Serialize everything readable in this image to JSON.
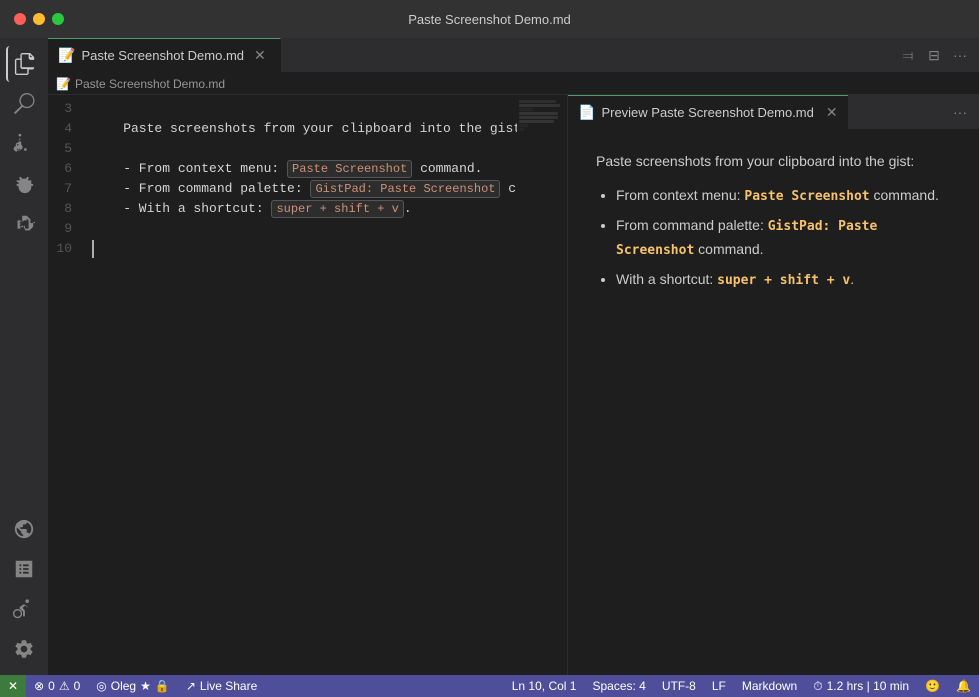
{
  "titlebar": {
    "title": "Paste Screenshot Demo.md"
  },
  "tabs": {
    "active_label": "Paste Screenshot Demo.md",
    "active_icon": "📄",
    "breadcrumb_text": "Paste Screenshot Demo.md"
  },
  "preview_tab": {
    "label": "Preview Paste Screenshot Demo.md"
  },
  "code_lines": [
    {
      "num": "3",
      "content": ""
    },
    {
      "num": "4",
      "content": "    Paste screenshots from your clipboard into the gist:"
    },
    {
      "num": "5",
      "content": ""
    },
    {
      "num": "6",
      "content": "    - From context menu: `Paste Screenshot` command."
    },
    {
      "num": "7",
      "content": "    - From command palette: `GistPad: Paste Screenshot` command."
    },
    {
      "num": "8",
      "content": "    - With a shortcut: `super + shift + v`."
    },
    {
      "num": "9",
      "content": ""
    },
    {
      "num": "10",
      "content": ""
    }
  ],
  "preview": {
    "intro": "Paste screenshots from your clipboard into the gist:",
    "items": [
      {
        "prefix": "From context menu: ",
        "kbd": "Paste Screenshot",
        "suffix": " command."
      },
      {
        "prefix": "From command palette: ",
        "kbd": "GistPad: Paste Screenshot",
        "suffix": " command."
      },
      {
        "prefix": "With a shortcut: ",
        "kbd": "super + shift + v",
        "suffix": "."
      }
    ]
  },
  "statusbar": {
    "x_label": "✕",
    "errors": "0",
    "warnings": "0",
    "user": "Oleg",
    "live_share": "Live Share",
    "position": "Ln 10, Col 1",
    "spaces": "Spaces: 4",
    "encoding": "UTF-8",
    "line_ending": "LF",
    "language": "Markdown",
    "time": "1.2 hrs | 10 min"
  },
  "activity_icons": [
    {
      "name": "files-icon",
      "symbol": "⧉"
    },
    {
      "name": "search-icon",
      "symbol": "🔍"
    },
    {
      "name": "source-control-icon",
      "symbol": "⑂"
    },
    {
      "name": "debug-icon",
      "symbol": "🐛"
    },
    {
      "name": "extensions-icon",
      "symbol": "⊞"
    },
    {
      "name": "remote-icon",
      "symbol": "📡"
    },
    {
      "name": "notebook-icon",
      "symbol": "📒"
    },
    {
      "name": "gistpad-icon",
      "symbol": "✱"
    }
  ]
}
